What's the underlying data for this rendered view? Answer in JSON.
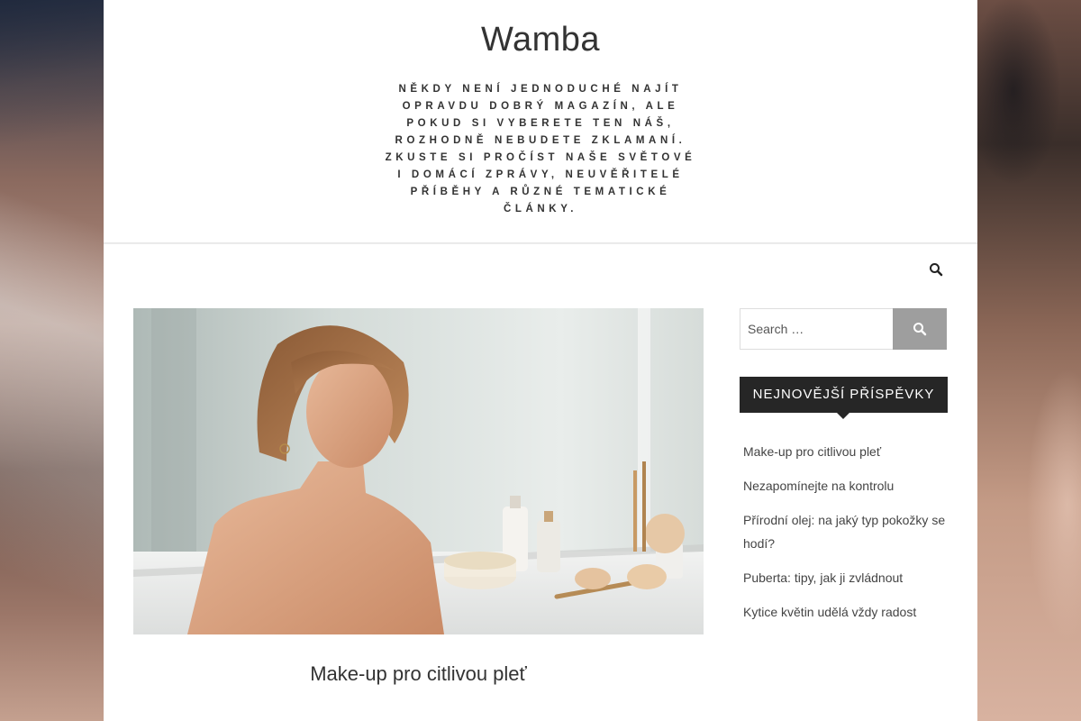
{
  "site": {
    "title": "Wamba",
    "description": "Někdy není jednoduché najít opravdu dobrý magazín, ale pokud si vyberete ten náš, rozhodně nebudete zklamaní. Zkuste si pročíst naše světové i domácí zprávy, neuvěřitelé příběhy a různé tematické články."
  },
  "nav": {
    "search_icon": "search-icon"
  },
  "post": {
    "title": "Make-up pro citlivou pleť",
    "image_alt": "woman-at-mirror-with-cosmetics"
  },
  "sidebar": {
    "search": {
      "placeholder": "Search …",
      "button_icon": "search-icon"
    },
    "recent_posts": {
      "title": "NEJNOVĚJŠÍ PŘÍSPĚVKY",
      "items": [
        "Make-up pro citlivou pleť",
        "Nezapomínejte na kontrolu",
        "Přírodní olej: na jaký typ pokožky se hodí?",
        "Puberta: tipy, jak ji zvládnout",
        "Kytice květin udělá vždy radost"
      ]
    }
  },
  "colors": {
    "widget_title_bg": "#262626",
    "search_button_bg": "#9e9e9e",
    "text": "#333333"
  }
}
